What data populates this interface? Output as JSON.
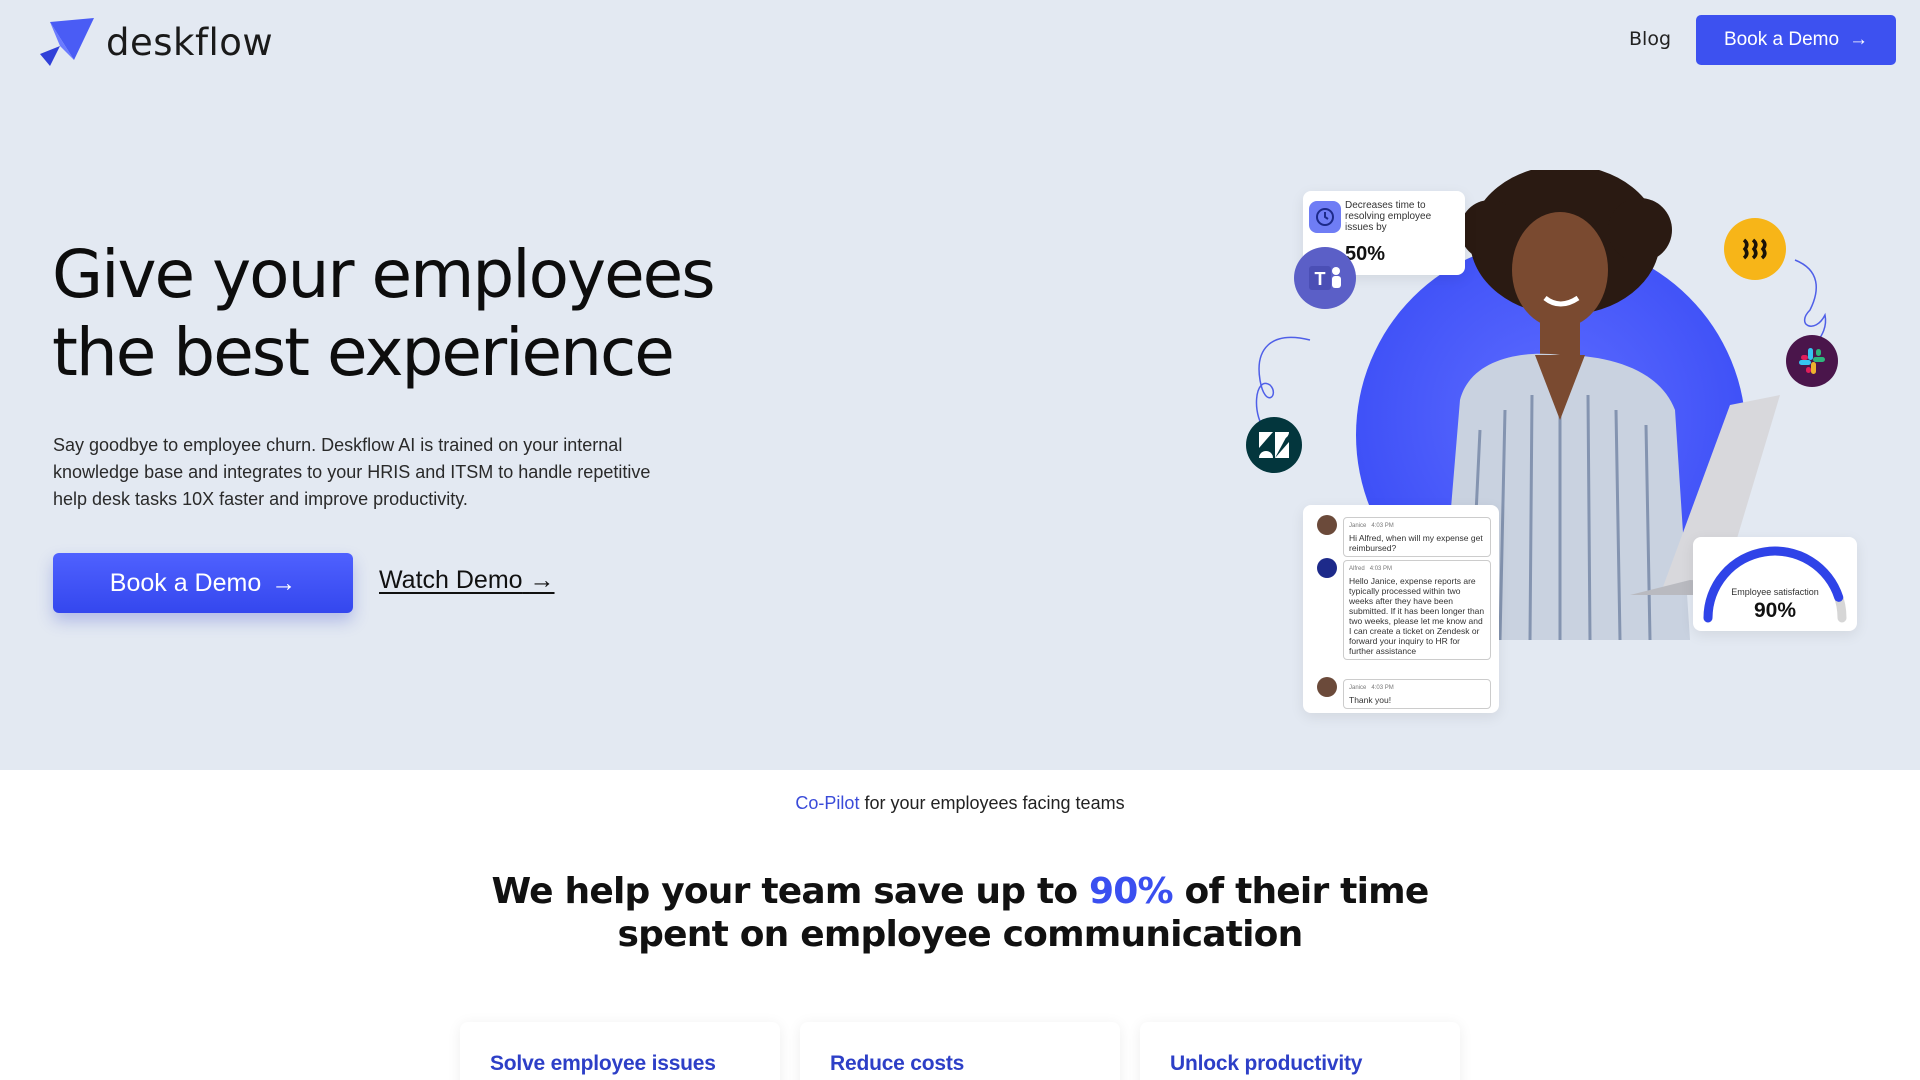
{
  "brand": {
    "name": "deskflow"
  },
  "nav": {
    "blog": "Blog",
    "cta": "Book a Demo"
  },
  "hero": {
    "title_line1": "Give your employees",
    "title_line2": "the best experience",
    "description": "Say goodbye to employee churn. Deskflow AI is trained on your internal knowledge base and integrates to your HRIS and ITSM to handle repetitive help desk tasks 10X faster and improve productivity.",
    "cta": "Book a Demo",
    "watch": "Watch Demo"
  },
  "illustration": {
    "stat_card": {
      "text": "Decreases time to resolving employee issues by",
      "value": "50%"
    },
    "chat": [
      {
        "name": "Janice",
        "time": "4:03 PM",
        "text": "Hi Alfred, when will my expense get reimbursed?"
      },
      {
        "name": "Alfred",
        "time": "4:03 PM",
        "text": "Hello Janice, expense reports are typically processed within two weeks after they have been submitted. If it has been longer than two weeks, please let me know and I can create a ticket on Zendesk or forward your inquiry to HR for further assistance"
      },
      {
        "name": "Janice",
        "time": "4:03 PM",
        "text": "Thank you!"
      }
    ],
    "satisfaction": {
      "label": "Employee satisfaction",
      "value": "90%",
      "level": 0.9
    },
    "icons": [
      "teams-icon",
      "zendesk-icon",
      "rippling-icon",
      "slack-icon"
    ]
  },
  "section": {
    "copilot_accent": "Co-Pilot",
    "copilot_rest": " for your employees facing teams",
    "title_pre": "We help your team save up to ",
    "title_accent": "90%",
    "title_post": " of their time spent on employee communication"
  },
  "features": [
    {
      "title": "Solve employee issues"
    },
    {
      "title": "Reduce costs"
    },
    {
      "title": "Unlock productivity"
    }
  ],
  "colors": {
    "accent": "#3d51f0",
    "hero_bg": "#e3e9f2",
    "feature_title": "#2d3fc7"
  },
  "glyphs": {
    "arrow": "→"
  }
}
